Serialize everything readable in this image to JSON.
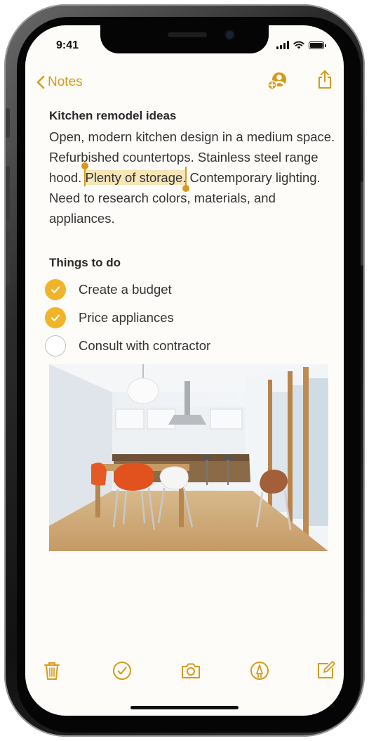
{
  "status_bar": {
    "time": "9:41"
  },
  "nav": {
    "back_label": "Notes",
    "collaborate_icon": "add-person-icon",
    "share_icon": "share-icon"
  },
  "note": {
    "title": "Kitchen remodel ideas",
    "body_before": "Open, modern kitchen design in a medium space. Refurbished countertops. Stainless steel range hood. ",
    "body_highlight": "Plenty of storage.",
    "body_after": " Contemporary lighting. Need to research colors, materials, and appliances."
  },
  "checklist": {
    "heading": "Things to do",
    "items": [
      {
        "label": "Create a budget",
        "checked": true
      },
      {
        "label": "Price appliances",
        "checked": true
      },
      {
        "label": "Consult with contractor",
        "checked": false
      }
    ]
  },
  "toolbar": {
    "icons": [
      "trash-icon",
      "checklist-icon",
      "camera-icon",
      "markup-icon",
      "compose-icon"
    ]
  },
  "colors": {
    "accent": "#d79a1b",
    "check_fill": "#f2b329",
    "highlight": "#f6e6b8",
    "background": "#fdfcf9"
  }
}
